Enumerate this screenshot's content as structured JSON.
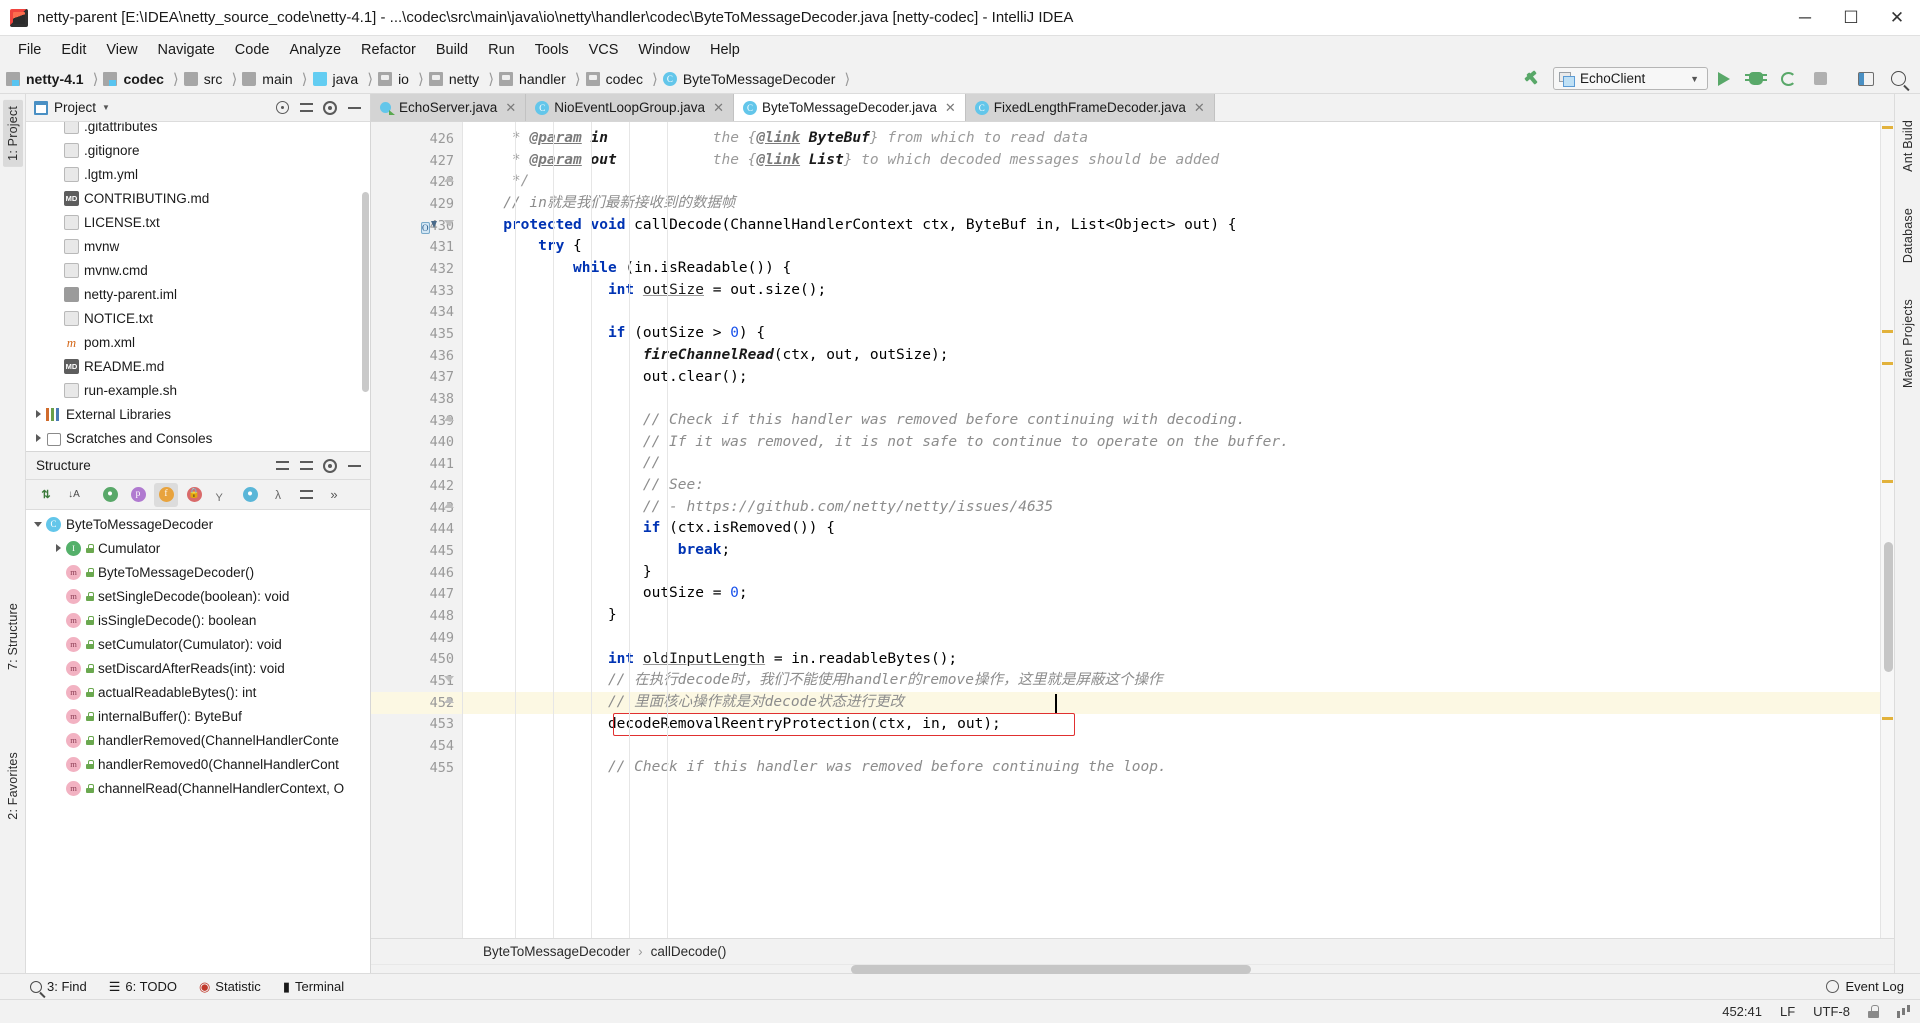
{
  "window": {
    "title": "netty-parent [E:\\IDEA\\netty_source_code\\netty-4.1] - ...\\codec\\src\\main\\java\\io\\netty\\handler\\codec\\ByteToMessageDecoder.java [netty-codec] - IntelliJ IDEA",
    "minimize": "─",
    "maximize": "☐",
    "close": "✕"
  },
  "menubar": [
    "File",
    "Edit",
    "View",
    "Navigate",
    "Code",
    "Analyze",
    "Refactor",
    "Build",
    "Run",
    "Tools",
    "VCS",
    "Window",
    "Help"
  ],
  "breadcrumb": [
    {
      "label": "netty-4.1",
      "icon": "module-icon",
      "bold": true
    },
    {
      "label": "codec",
      "icon": "module-icon",
      "bold": true
    },
    {
      "label": "src",
      "icon": "folder-icon",
      "bold": false
    },
    {
      "label": "main",
      "icon": "folder-icon",
      "bold": false
    },
    {
      "label": "java",
      "icon": "source-folder-icon",
      "bold": false
    },
    {
      "label": "io",
      "icon": "package-icon",
      "bold": false
    },
    {
      "label": "netty",
      "icon": "package-icon",
      "bold": false
    },
    {
      "label": "handler",
      "icon": "package-icon",
      "bold": false
    },
    {
      "label": "codec",
      "icon": "package-icon",
      "bold": false
    },
    {
      "label": "ByteToMessageDecoder",
      "icon": "class-icon",
      "bold": false
    }
  ],
  "toolbar": {
    "run_configuration": "EchoClient",
    "config_dropdown": "▼",
    "run_label": "Run",
    "debug_label": "Debug",
    "run_with_coverage_label": "Run with Coverage",
    "stop_label": "Stop",
    "layout_label": "Layout",
    "search_label": "Search Everywhere",
    "build_label": "Build Project"
  },
  "project_panel": {
    "title": "Project",
    "caret": "▼",
    "items": [
      {
        "label": ".gitattributes",
        "icon": "file-icon",
        "indent": 1,
        "arrow": "none",
        "partial": true
      },
      {
        "label": ".gitignore",
        "icon": "file-icon",
        "indent": 1,
        "arrow": "none"
      },
      {
        "label": ".lgtm.yml",
        "icon": "yaml-icon",
        "indent": 1,
        "arrow": "none"
      },
      {
        "label": "CONTRIBUTING.md",
        "icon": "markdown-icon",
        "indent": 1,
        "arrow": "none"
      },
      {
        "label": "LICENSE.txt",
        "icon": "text-icon",
        "indent": 1,
        "arrow": "none"
      },
      {
        "label": "mvnw",
        "icon": "file-icon",
        "indent": 1,
        "arrow": "none"
      },
      {
        "label": "mvnw.cmd",
        "icon": "file-icon",
        "indent": 1,
        "arrow": "none"
      },
      {
        "label": "netty-parent.iml",
        "icon": "iml-icon",
        "indent": 1,
        "arrow": "none"
      },
      {
        "label": "NOTICE.txt",
        "icon": "text-icon",
        "indent": 1,
        "arrow": "none"
      },
      {
        "label": "pom.xml",
        "icon": "xml-icon",
        "indent": 1,
        "arrow": "none"
      },
      {
        "label": "README.md",
        "icon": "markdown-icon",
        "indent": 1,
        "arrow": "none"
      },
      {
        "label": "run-example.sh",
        "icon": "shell-icon",
        "indent": 1,
        "arrow": "none"
      },
      {
        "label": "External Libraries",
        "icon": "library-icon",
        "indent": 0,
        "arrow": "right"
      },
      {
        "label": "Scratches and Consoles",
        "icon": "scratch-icon",
        "indent": 0,
        "arrow": "right"
      }
    ]
  },
  "structure_panel": {
    "title": "Structure",
    "items": [
      {
        "label": "ByteToMessageDecoder",
        "icon": "class-icon",
        "badge": "C",
        "indent": 0,
        "arrow": "down",
        "lock": false
      },
      {
        "label": "Cumulator",
        "icon": "interface-icon",
        "badge": "I",
        "indent": 1,
        "arrow": "right",
        "lock": true
      },
      {
        "label": "ByteToMessageDecoder()",
        "icon": "method-icon",
        "badge": "m",
        "indent": 1,
        "arrow": "none",
        "lock": true
      },
      {
        "label": "setSingleDecode(boolean): void",
        "icon": "method-icon",
        "badge": "m",
        "indent": 1,
        "arrow": "none",
        "lock": true
      },
      {
        "label": "isSingleDecode(): boolean",
        "icon": "method-icon",
        "badge": "m",
        "indent": 1,
        "arrow": "none",
        "lock": true
      },
      {
        "label": "setCumulator(Cumulator): void",
        "icon": "method-icon",
        "badge": "m",
        "indent": 1,
        "arrow": "none",
        "lock": true
      },
      {
        "label": "setDiscardAfterReads(int): void",
        "icon": "method-icon",
        "badge": "m",
        "indent": 1,
        "arrow": "none",
        "lock": true
      },
      {
        "label": "actualReadableBytes(): int",
        "icon": "method-icon",
        "badge": "m",
        "indent": 1,
        "arrow": "none",
        "lock": true
      },
      {
        "label": "internalBuffer(): ByteBuf",
        "icon": "method-icon",
        "badge": "m",
        "indent": 1,
        "arrow": "none",
        "lock": true
      },
      {
        "label": "handlerRemoved(ChannelHandlerConte",
        "icon": "method-icon",
        "badge": "m",
        "indent": 1,
        "arrow": "none",
        "lock": true
      },
      {
        "label": "handlerRemoved0(ChannelHandlerCont",
        "icon": "method-icon",
        "badge": "m",
        "indent": 1,
        "arrow": "none",
        "lock": true
      },
      {
        "label": "channelRead(ChannelHandlerContext, O",
        "icon": "method-icon",
        "badge": "m",
        "indent": 1,
        "arrow": "none",
        "lock": true
      }
    ]
  },
  "editor_tabs": [
    {
      "label": "EchoServer.java",
      "icon": "java-runnable-icon",
      "active": false,
      "close": "✕"
    },
    {
      "label": "NioEventLoopGroup.java",
      "icon": "java-class-icon",
      "active": false,
      "close": "✕"
    },
    {
      "label": "ByteToMessageDecoder.java",
      "icon": "java-class-icon",
      "active": true,
      "close": "✕"
    },
    {
      "label": "FixedLengthFrameDecoder.java",
      "icon": "java-class-icon",
      "active": false,
      "close": "✕"
    }
  ],
  "code": {
    "first_line_number": 426,
    "lines": [
      {
        "n": 426,
        "tokens": [
          {
            "t": "    * ",
            "c": "jdoc"
          },
          {
            "t": "@param",
            "c": "jdoc-t"
          },
          {
            "t": " ",
            "c": "jdoc"
          },
          {
            "t": "in",
            "c": "jdoc-p"
          },
          {
            "t": "            the {",
            "c": "jdoc"
          },
          {
            "t": "@link",
            "c": "jdoc-t"
          },
          {
            "t": " ",
            "c": "jdoc"
          },
          {
            "t": "ByteBuf",
            "c": "jdoc-p"
          },
          {
            "t": "} from which to read data",
            "c": "jdoc"
          }
        ]
      },
      {
        "n": 427,
        "tokens": [
          {
            "t": "    * ",
            "c": "jdoc"
          },
          {
            "t": "@param",
            "c": "jdoc-t"
          },
          {
            "t": " ",
            "c": "jdoc"
          },
          {
            "t": "out",
            "c": "jdoc-p"
          },
          {
            "t": "           the {",
            "c": "jdoc"
          },
          {
            "t": "@link",
            "c": "jdoc-t"
          },
          {
            "t": " ",
            "c": "jdoc"
          },
          {
            "t": "List",
            "c": "jdoc-p"
          },
          {
            "t": "} to which decoded messages should be added",
            "c": "jdoc"
          }
        ]
      },
      {
        "n": 428,
        "fold": "end",
        "tokens": [
          {
            "t": "    */",
            "c": "jdoc"
          }
        ]
      },
      {
        "n": 429,
        "tokens": [
          {
            "t": "   // in就是我们最新接收到的数据帧",
            "c": "cmt"
          }
        ]
      },
      {
        "n": 430,
        "fold": "start",
        "overrideIcon": true,
        "tokens": [
          {
            "t": "   ",
            "c": ""
          },
          {
            "t": "protected",
            "c": "kw"
          },
          {
            "t": " ",
            "c": ""
          },
          {
            "t": "void",
            "c": "kw"
          },
          {
            "t": " ",
            "c": ""
          },
          {
            "t": "callDecode",
            "c": ""
          },
          {
            "t": "(ChannelHandlerContext ctx, ByteBuf in, List<Object> out) {",
            "c": ""
          }
        ]
      },
      {
        "n": 431,
        "tokens": [
          {
            "t": "       ",
            "c": ""
          },
          {
            "t": "try",
            "c": "kw"
          },
          {
            "t": " {",
            "c": ""
          }
        ]
      },
      {
        "n": 432,
        "tokens": [
          {
            "t": "           ",
            "c": ""
          },
          {
            "t": "while",
            "c": "kw"
          },
          {
            "t": " (in.isReadable()) {",
            "c": ""
          }
        ]
      },
      {
        "n": 433,
        "tokens": [
          {
            "t": "               ",
            "c": ""
          },
          {
            "t": "int",
            "c": "kw"
          },
          {
            "t": " ",
            "c": ""
          },
          {
            "t": "outSize",
            "c": "fld"
          },
          {
            "t": " = out.size();",
            "c": ""
          }
        ]
      },
      {
        "n": 434,
        "tokens": [
          {
            "t": "",
            "c": ""
          }
        ]
      },
      {
        "n": 435,
        "tokens": [
          {
            "t": "               ",
            "c": ""
          },
          {
            "t": "if",
            "c": "kw"
          },
          {
            "t": " (outSize > ",
            "c": ""
          },
          {
            "t": "0",
            "c": "num"
          },
          {
            "t": ") {",
            "c": ""
          }
        ]
      },
      {
        "n": 436,
        "tokens": [
          {
            "t": "                   ",
            "c": ""
          },
          {
            "t": "fireChannelRead",
            "c": "fn"
          },
          {
            "t": "(ctx, out, outSize);",
            "c": ""
          }
        ]
      },
      {
        "n": 437,
        "tokens": [
          {
            "t": "                   out.clear();",
            "c": ""
          }
        ]
      },
      {
        "n": 438,
        "tokens": [
          {
            "t": "",
            "c": ""
          }
        ]
      },
      {
        "n": 439,
        "fold": "end",
        "tokens": [
          {
            "t": "                   // Check if this handler was removed before continuing with decoding.",
            "c": "cmt"
          }
        ]
      },
      {
        "n": 440,
        "tokens": [
          {
            "t": "                   // If it was removed, it is not safe to continue to operate on the buffer.",
            "c": "cmt"
          }
        ]
      },
      {
        "n": 441,
        "tokens": [
          {
            "t": "                   //",
            "c": "cmt"
          }
        ]
      },
      {
        "n": 442,
        "tokens": [
          {
            "t": "                   // See:",
            "c": "cmt"
          }
        ]
      },
      {
        "n": 443,
        "fold": "end",
        "tokens": [
          {
            "t": "                   // - https://github.com/netty/netty/issues/4635",
            "c": "cmt"
          }
        ]
      },
      {
        "n": 444,
        "tokens": [
          {
            "t": "                   ",
            "c": ""
          },
          {
            "t": "if",
            "c": "kw"
          },
          {
            "t": " (ctx.isRemoved()) {",
            "c": ""
          }
        ]
      },
      {
        "n": 445,
        "tokens": [
          {
            "t": "                       ",
            "c": ""
          },
          {
            "t": "break",
            "c": "kw"
          },
          {
            "t": ";",
            "c": ""
          }
        ]
      },
      {
        "n": 446,
        "tokens": [
          {
            "t": "                   }",
            "c": ""
          }
        ]
      },
      {
        "n": 447,
        "tokens": [
          {
            "t": "                   outSize = ",
            "c": ""
          },
          {
            "t": "0",
            "c": "num"
          },
          {
            "t": ";",
            "c": ""
          }
        ]
      },
      {
        "n": 448,
        "tokens": [
          {
            "t": "               }",
            "c": ""
          }
        ]
      },
      {
        "n": 449,
        "tokens": [
          {
            "t": "",
            "c": ""
          }
        ]
      },
      {
        "n": 450,
        "tokens": [
          {
            "t": "               ",
            "c": ""
          },
          {
            "t": "int",
            "c": "kw"
          },
          {
            "t": " ",
            "c": ""
          },
          {
            "t": "oldInputLength",
            "c": "fld"
          },
          {
            "t": " = in.readableBytes();",
            "c": ""
          }
        ]
      },
      {
        "n": 451,
        "fold": "start",
        "tokens": [
          {
            "t": "               // 在执行decode时，我们不能使用handler的remove操作，这里就是屏蔽这个操作",
            "c": "cmt"
          }
        ]
      },
      {
        "n": 452,
        "highlight": true,
        "fold": "end",
        "tokens": [
          {
            "t": "               // 里面核心操作就是对decode状态进行更改",
            "c": "cmt"
          }
        ]
      },
      {
        "n": 453,
        "boxed": true,
        "tokens": [
          {
            "t": "               decodeRemovalReentryProtection(ctx, in, out);",
            "c": ""
          }
        ]
      },
      {
        "n": 454,
        "tokens": [
          {
            "t": "",
            "c": ""
          }
        ]
      },
      {
        "n": 455,
        "tokens": [
          {
            "t": "               // Check if this handler was removed before continuing the loop.",
            "c": "cmt"
          }
        ]
      }
    ]
  },
  "editor_breadcrumb": {
    "class": "ByteToMessageDecoder",
    "separator": "›",
    "method": "callDecode()"
  },
  "left_tool_tabs": [
    {
      "label": "1: Project",
      "selected": true
    },
    {
      "label": "7: Structure",
      "selected": false
    },
    {
      "label": "2: Favorites",
      "selected": false
    }
  ],
  "right_tool_tabs": [
    {
      "label": "Ant Build"
    },
    {
      "label": "Database"
    },
    {
      "label": "Maven Projects"
    }
  ],
  "bottom_bar": [
    {
      "label": "3: Find",
      "icon": "search-icon"
    },
    {
      "label": "6: TODO",
      "icon": "list-icon"
    },
    {
      "label": "Statistic",
      "icon": "chart-icon"
    },
    {
      "label": "Terminal",
      "icon": "terminal-icon"
    }
  ],
  "event_log": {
    "label": "Event Log",
    "icon": "bell-icon"
  },
  "statusbar": {
    "caret_position": "452:41",
    "line_separator": "LF",
    "encoding": "UTF-8",
    "lock_icon": "lock-icon",
    "branch_icon": "branch-icon"
  },
  "colors": {
    "accent_blue": "#4a90c4",
    "keyword_blue": "#0033b3",
    "comment_gray": "#8c8c8c",
    "highlight_yellow": "#fcf8e3",
    "error_red": "#e03030",
    "green": "#59a869"
  }
}
